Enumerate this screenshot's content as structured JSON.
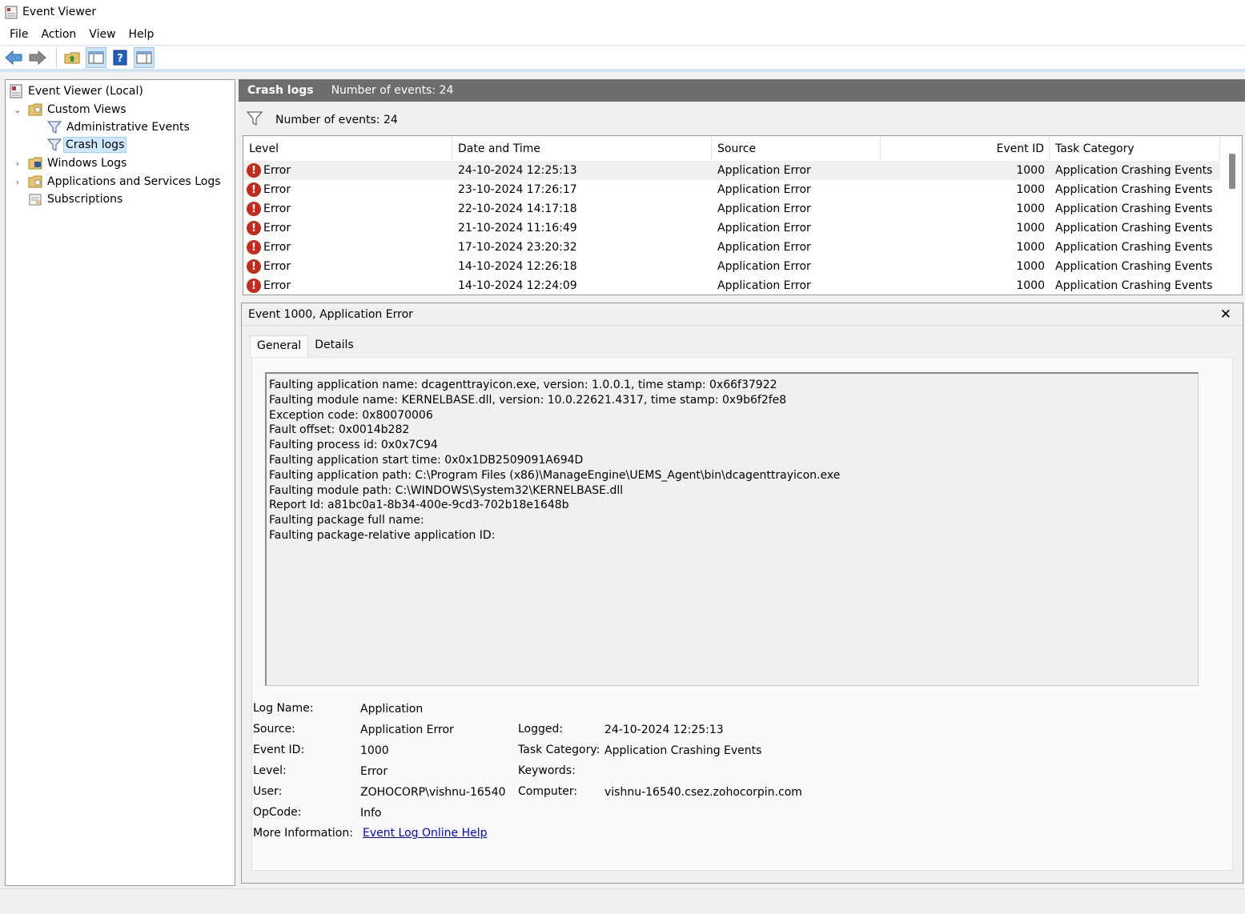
{
  "window": {
    "title": "Event Viewer"
  },
  "menu": [
    {
      "label": "File"
    },
    {
      "label": "Action"
    },
    {
      "label": "View"
    },
    {
      "label": "Help"
    }
  ],
  "toolbar": {
    "buttons": [
      "back-arrow-icon",
      "forward-arrow-icon",
      "folder-up-icon",
      "show-hide-console-tree-icon",
      "help-icon",
      "show-hide-action-pane-icon"
    ]
  },
  "tree": {
    "root": "Event Viewer (Local)",
    "custom_views": "Custom Views",
    "admin_events": "Administrative Events",
    "crash_logs": "Crash logs",
    "windows_logs": "Windows Logs",
    "app_services_logs": "Applications and Services Logs",
    "subscriptions": "Subscriptions"
  },
  "view_header": {
    "name": "Crash logs",
    "count": "Number of events: 24"
  },
  "filter": {
    "text": "Number of events: 24"
  },
  "grid": {
    "columns": {
      "level": "Level",
      "datetime": "Date and Time",
      "source": "Source",
      "event_id": "Event ID",
      "task_category": "Task Category"
    },
    "rows": [
      {
        "level": "Error",
        "datetime": "24-10-2024 12:25:13",
        "source": "Application Error",
        "event_id": "1000",
        "task_category": "Application Crashing Events"
      },
      {
        "level": "Error",
        "datetime": "23-10-2024 17:26:17",
        "source": "Application Error",
        "event_id": "1000",
        "task_category": "Application Crashing Events"
      },
      {
        "level": "Error",
        "datetime": "22-10-2024 14:17:18",
        "source": "Application Error",
        "event_id": "1000",
        "task_category": "Application Crashing Events"
      },
      {
        "level": "Error",
        "datetime": "21-10-2024 11:16:49",
        "source": "Application Error",
        "event_id": "1000",
        "task_category": "Application Crashing Events"
      },
      {
        "level": "Error",
        "datetime": "17-10-2024 23:20:32",
        "source": "Application Error",
        "event_id": "1000",
        "task_category": "Application Crashing Events"
      },
      {
        "level": "Error",
        "datetime": "14-10-2024 12:26:18",
        "source": "Application Error",
        "event_id": "1000",
        "task_category": "Application Crashing Events"
      },
      {
        "level": "Error",
        "datetime": "14-10-2024 12:24:09",
        "source": "Application Error",
        "event_id": "1000",
        "task_category": "Application Crashing Events"
      }
    ]
  },
  "detail": {
    "title": "Event 1000, Application Error",
    "tabs": [
      "General",
      "Details"
    ],
    "description": [
      "Faulting application name: dcagenttrayicon.exe, version: 1.0.0.1, time stamp: 0x66f37922",
      "Faulting module name: KERNELBASE.dll, version: 10.0.22621.4317, time stamp: 0x9b6f2fe8",
      "Exception code: 0x80070006",
      "Fault offset: 0x0014b282",
      "Faulting process id: 0x0x7C94",
      "Faulting application start time: 0x0x1DB2509091A694D",
      "Faulting application path: C:\\Program Files (x86)\\ManageEngine\\UEMS_Agent\\bin\\dcagenttrayicon.exe",
      "Faulting module path: C:\\WINDOWS\\System32\\KERNELBASE.dll",
      "Report Id: a81bc0a1-8b34-400e-9cd3-702b18e1648b",
      "Faulting package full name:",
      "Faulting package-relative application ID:"
    ],
    "props": {
      "log_name_label": "Log Name:",
      "log_name": "Application",
      "source_label": "Source:",
      "source": "Application Error",
      "logged_label": "Logged:",
      "logged": "24-10-2024 12:25:13",
      "event_id_label": "Event ID:",
      "event_id": "1000",
      "task_category_label": "Task Category:",
      "task_category": "Application Crashing Events",
      "level_label": "Level:",
      "level": "Error",
      "keywords_label": "Keywords:",
      "keywords": "",
      "user_label": "User:",
      "user": "ZOHOCORP\\vishnu-16540",
      "computer_label": "Computer:",
      "computer": "vishnu-16540.csez.zohocorpin.com",
      "opcode_label": "OpCode:",
      "opcode": "Info",
      "more_info_label": "More Information:",
      "more_info_link": "Event Log Online Help"
    }
  },
  "colors": {
    "accent": "#c42b1c",
    "header_bg": "#6d6d6d",
    "selection": "#cce8ff",
    "link": "#0000ee"
  }
}
